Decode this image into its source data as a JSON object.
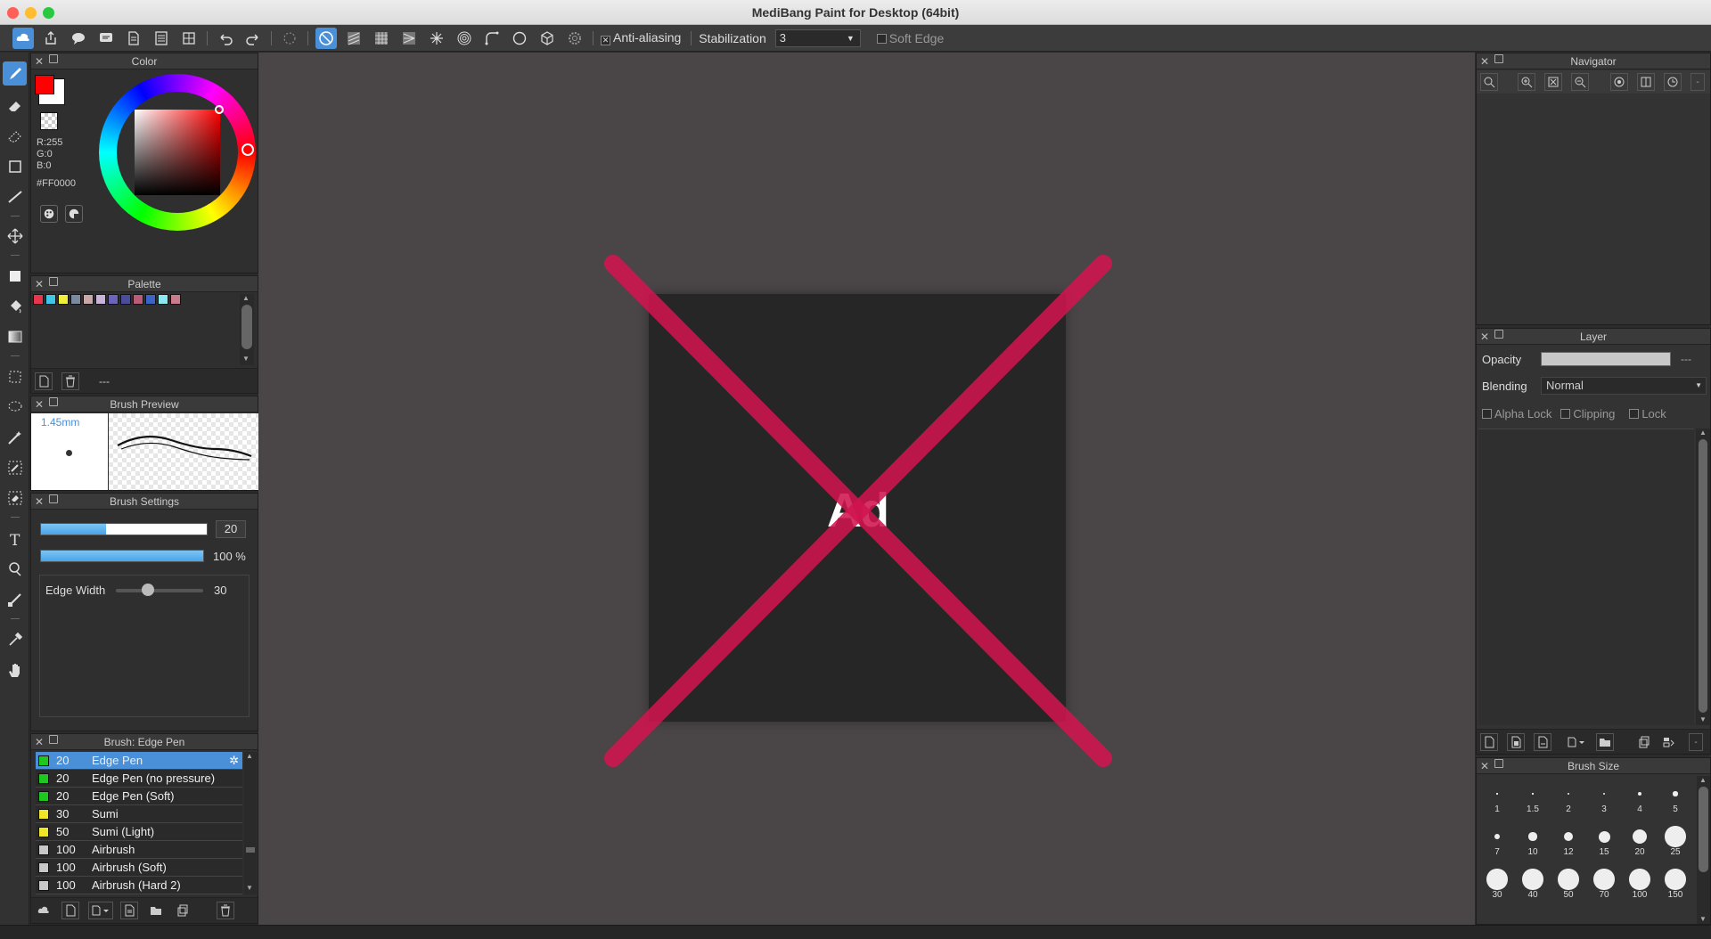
{
  "window": {
    "title": "MediBang Paint for Desktop (64bit)"
  },
  "toolbar": {
    "antialias_label": "Anti-aliasing",
    "antialias_checked": true,
    "stabilization_label": "Stabilization",
    "stabilization_value": "3",
    "soft_edge_label": "Soft Edge",
    "soft_edge_checked": false
  },
  "color_panel": {
    "title": "Color",
    "r": "R:255",
    "g": "G:0",
    "b": "B:0",
    "hex": "#FF0000",
    "main_color": "#ff0000",
    "sub_color": "#ffffff"
  },
  "palette_panel": {
    "title": "Palette",
    "swatches": [
      "#e8364f",
      "#3cc8e6",
      "#f0f03c",
      "#7c8aa0",
      "#c8a8a8",
      "#c8b4d8",
      "#6c64b8",
      "#4c4c9c",
      "#b85c78",
      "#3c64c8",
      "#8ce8f0",
      "#c87c8c"
    ],
    "name": "---"
  },
  "brush_preview": {
    "title": "Brush Preview",
    "size": "1.45mm"
  },
  "brush_settings": {
    "title": "Brush Settings",
    "size_value": "20",
    "size_fraction": 0.39,
    "opacity_value": "100 %",
    "opacity_fraction": 1.0,
    "edge_width_label": "Edge Width",
    "edge_width_value": "30",
    "edge_width_fraction": 0.37
  },
  "brush_list": {
    "title": "Brush: Edge Pen",
    "items": [
      {
        "size": "20",
        "name": "Edge Pen",
        "color": "#1ec81e",
        "selected": true
      },
      {
        "size": "20",
        "name": "Edge Pen (no pressure)",
        "color": "#1ec81e",
        "selected": false
      },
      {
        "size": "20",
        "name": "Edge Pen (Soft)",
        "color": "#1ec81e",
        "selected": false
      },
      {
        "size": "30",
        "name": "Sumi",
        "color": "#f0e628",
        "selected": false
      },
      {
        "size": "50",
        "name": "Sumi (Light)",
        "color": "#f0e628",
        "selected": false
      },
      {
        "size": "100",
        "name": "Airbrush",
        "color": "#c8c8c8",
        "selected": false
      },
      {
        "size": "100",
        "name": "Airbrush (Soft)",
        "color": "#c8c8c8",
        "selected": false
      },
      {
        "size": "100",
        "name": "Airbrush (Hard 2)",
        "color": "#c8c8c8",
        "selected": false
      }
    ]
  },
  "canvas": {
    "ad_text": "Ad"
  },
  "navigator": {
    "title": "Navigator"
  },
  "layer_panel": {
    "title": "Layer",
    "opacity_label": "Opacity",
    "opacity_value": "---",
    "blending_label": "Blending",
    "blending_value": "Normal",
    "alpha_lock": "Alpha Lock",
    "clipping": "Clipping",
    "lock": "Lock",
    "footer_value": "-"
  },
  "brush_size_panel": {
    "title": "Brush Size",
    "sizes": [
      "1",
      "1.5",
      "2",
      "3",
      "4",
      "5",
      "7",
      "10",
      "12",
      "15",
      "20",
      "25",
      "30",
      "40",
      "50",
      "70",
      "100",
      "150"
    ]
  }
}
